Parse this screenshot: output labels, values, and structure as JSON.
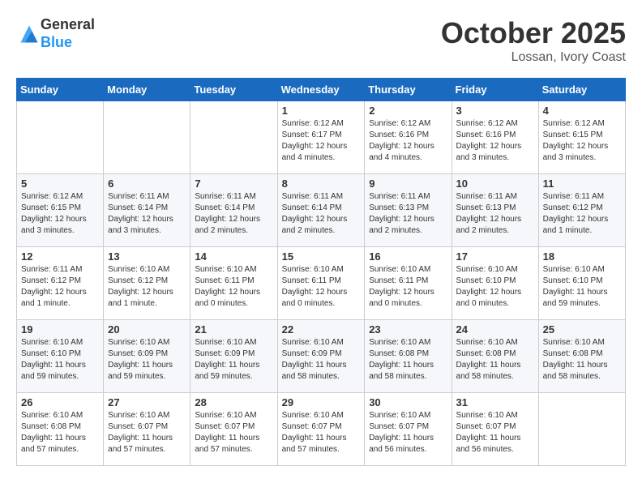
{
  "header": {
    "logo_line1": "General",
    "logo_line2": "Blue",
    "month": "October 2025",
    "location": "Lossan, Ivory Coast"
  },
  "weekdays": [
    "Sunday",
    "Monday",
    "Tuesday",
    "Wednesday",
    "Thursday",
    "Friday",
    "Saturday"
  ],
  "weeks": [
    [
      {
        "day": "",
        "info": ""
      },
      {
        "day": "",
        "info": ""
      },
      {
        "day": "",
        "info": ""
      },
      {
        "day": "1",
        "info": "Sunrise: 6:12 AM\nSunset: 6:17 PM\nDaylight: 12 hours\nand 4 minutes."
      },
      {
        "day": "2",
        "info": "Sunrise: 6:12 AM\nSunset: 6:16 PM\nDaylight: 12 hours\nand 4 minutes."
      },
      {
        "day": "3",
        "info": "Sunrise: 6:12 AM\nSunset: 6:16 PM\nDaylight: 12 hours\nand 3 minutes."
      },
      {
        "day": "4",
        "info": "Sunrise: 6:12 AM\nSunset: 6:15 PM\nDaylight: 12 hours\nand 3 minutes."
      }
    ],
    [
      {
        "day": "5",
        "info": "Sunrise: 6:12 AM\nSunset: 6:15 PM\nDaylight: 12 hours\nand 3 minutes."
      },
      {
        "day": "6",
        "info": "Sunrise: 6:11 AM\nSunset: 6:14 PM\nDaylight: 12 hours\nand 3 minutes."
      },
      {
        "day": "7",
        "info": "Sunrise: 6:11 AM\nSunset: 6:14 PM\nDaylight: 12 hours\nand 2 minutes."
      },
      {
        "day": "8",
        "info": "Sunrise: 6:11 AM\nSunset: 6:14 PM\nDaylight: 12 hours\nand 2 minutes."
      },
      {
        "day": "9",
        "info": "Sunrise: 6:11 AM\nSunset: 6:13 PM\nDaylight: 12 hours\nand 2 minutes."
      },
      {
        "day": "10",
        "info": "Sunrise: 6:11 AM\nSunset: 6:13 PM\nDaylight: 12 hours\nand 2 minutes."
      },
      {
        "day": "11",
        "info": "Sunrise: 6:11 AM\nSunset: 6:12 PM\nDaylight: 12 hours\nand 1 minute."
      }
    ],
    [
      {
        "day": "12",
        "info": "Sunrise: 6:11 AM\nSunset: 6:12 PM\nDaylight: 12 hours\nand 1 minute."
      },
      {
        "day": "13",
        "info": "Sunrise: 6:10 AM\nSunset: 6:12 PM\nDaylight: 12 hours\nand 1 minute."
      },
      {
        "day": "14",
        "info": "Sunrise: 6:10 AM\nSunset: 6:11 PM\nDaylight: 12 hours\nand 0 minutes."
      },
      {
        "day": "15",
        "info": "Sunrise: 6:10 AM\nSunset: 6:11 PM\nDaylight: 12 hours\nand 0 minutes."
      },
      {
        "day": "16",
        "info": "Sunrise: 6:10 AM\nSunset: 6:11 PM\nDaylight: 12 hours\nand 0 minutes."
      },
      {
        "day": "17",
        "info": "Sunrise: 6:10 AM\nSunset: 6:10 PM\nDaylight: 12 hours\nand 0 minutes."
      },
      {
        "day": "18",
        "info": "Sunrise: 6:10 AM\nSunset: 6:10 PM\nDaylight: 11 hours\nand 59 minutes."
      }
    ],
    [
      {
        "day": "19",
        "info": "Sunrise: 6:10 AM\nSunset: 6:10 PM\nDaylight: 11 hours\nand 59 minutes."
      },
      {
        "day": "20",
        "info": "Sunrise: 6:10 AM\nSunset: 6:09 PM\nDaylight: 11 hours\nand 59 minutes."
      },
      {
        "day": "21",
        "info": "Sunrise: 6:10 AM\nSunset: 6:09 PM\nDaylight: 11 hours\nand 59 minutes."
      },
      {
        "day": "22",
        "info": "Sunrise: 6:10 AM\nSunset: 6:09 PM\nDaylight: 11 hours\nand 58 minutes."
      },
      {
        "day": "23",
        "info": "Sunrise: 6:10 AM\nSunset: 6:08 PM\nDaylight: 11 hours\nand 58 minutes."
      },
      {
        "day": "24",
        "info": "Sunrise: 6:10 AM\nSunset: 6:08 PM\nDaylight: 11 hours\nand 58 minutes."
      },
      {
        "day": "25",
        "info": "Sunrise: 6:10 AM\nSunset: 6:08 PM\nDaylight: 11 hours\nand 58 minutes."
      }
    ],
    [
      {
        "day": "26",
        "info": "Sunrise: 6:10 AM\nSunset: 6:08 PM\nDaylight: 11 hours\nand 57 minutes."
      },
      {
        "day": "27",
        "info": "Sunrise: 6:10 AM\nSunset: 6:07 PM\nDaylight: 11 hours\nand 57 minutes."
      },
      {
        "day": "28",
        "info": "Sunrise: 6:10 AM\nSunset: 6:07 PM\nDaylight: 11 hours\nand 57 minutes."
      },
      {
        "day": "29",
        "info": "Sunrise: 6:10 AM\nSunset: 6:07 PM\nDaylight: 11 hours\nand 57 minutes."
      },
      {
        "day": "30",
        "info": "Sunrise: 6:10 AM\nSunset: 6:07 PM\nDaylight: 11 hours\nand 56 minutes."
      },
      {
        "day": "31",
        "info": "Sunrise: 6:10 AM\nSunset: 6:07 PM\nDaylight: 11 hours\nand 56 minutes."
      },
      {
        "day": "",
        "info": ""
      }
    ]
  ]
}
